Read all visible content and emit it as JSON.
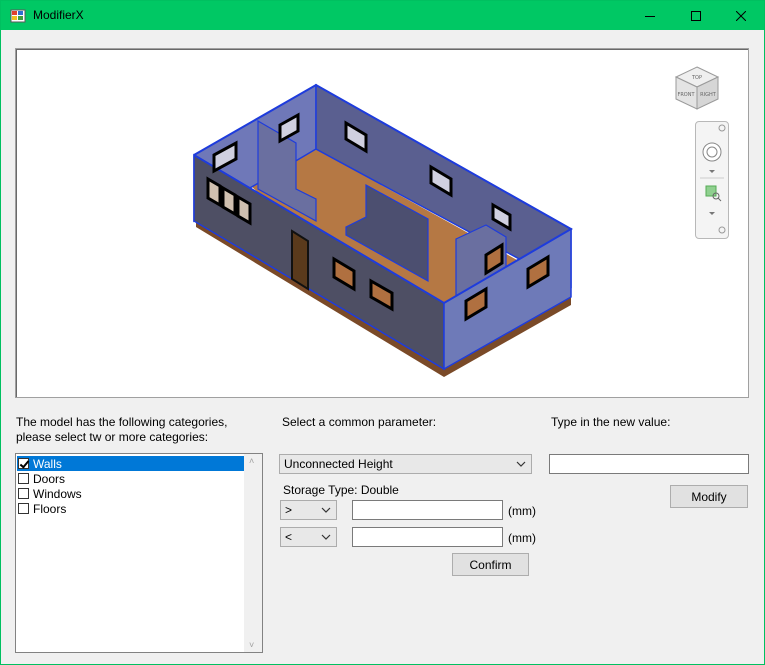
{
  "window": {
    "title": "ModifierX"
  },
  "categories": {
    "prompt_line1": "The model has the following categories,",
    "prompt_line2": "please select tw or more categories:",
    "items": [
      {
        "label": "Walls",
        "checked": true,
        "selected": true
      },
      {
        "label": "Doors",
        "checked": false,
        "selected": false
      },
      {
        "label": "Windows",
        "checked": false,
        "selected": false
      },
      {
        "label": "Floors",
        "checked": false,
        "selected": false
      }
    ]
  },
  "parameter": {
    "prompt": "Select a common parameter:",
    "selected": "Unconnected Height",
    "storage_type": "Storage Type: Double",
    "filter1": {
      "operator": ">",
      "value": "",
      "unit": "(mm)"
    },
    "filter2": {
      "operator": "<",
      "value": "",
      "unit": "(mm)"
    },
    "confirm_label": "Confirm"
  },
  "new_value": {
    "prompt": "Type in the new value:",
    "value": "",
    "modify_label": "Modify"
  },
  "viewcube": {
    "faces": [
      "TOP",
      "FRONT",
      "RIGHT"
    ]
  },
  "colors": {
    "titlebar": "#00c864",
    "selection": "#0078d7",
    "wall_fill": "#4a5ab4",
    "wall_edge": "#1e3cdc",
    "floor": "#b07040"
  }
}
